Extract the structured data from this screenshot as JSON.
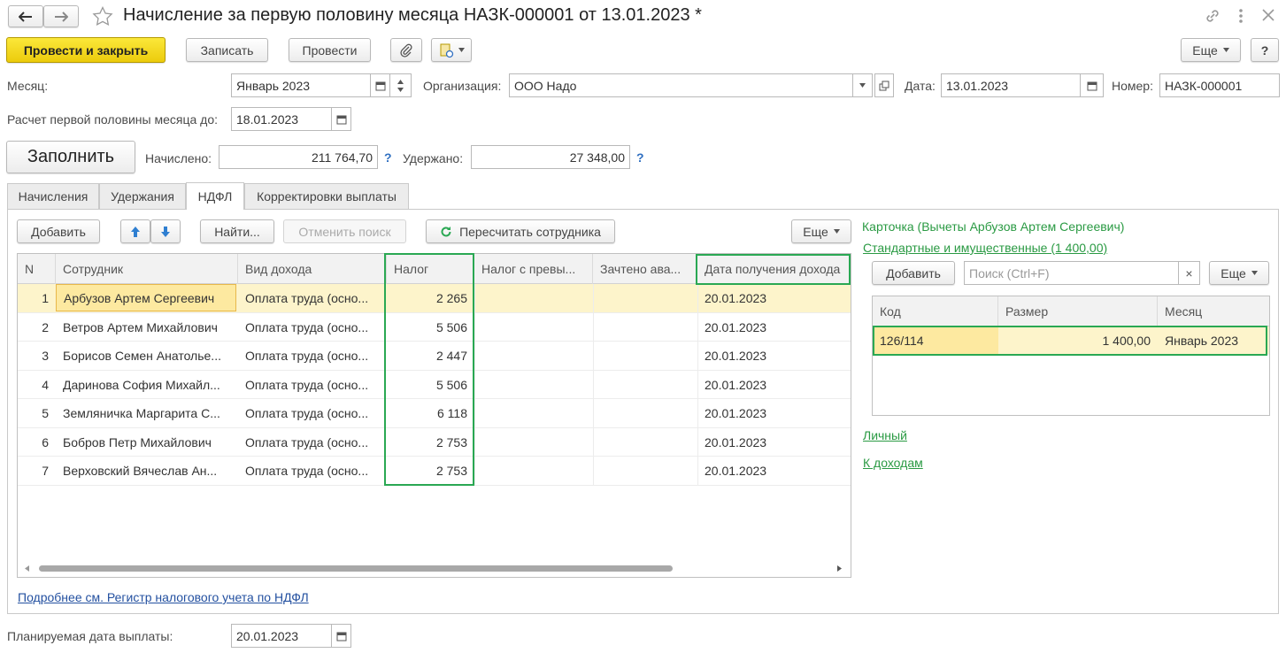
{
  "window": {
    "title": "Начисление за первую половину месяца НАЗК-000001 от 13.01.2023 *"
  },
  "toolbar": {
    "post_close": "Провести и закрыть",
    "save": "Записать",
    "post": "Провести",
    "more": "Еще",
    "help": "?"
  },
  "fields": {
    "month_label": "Месяц:",
    "month_value": "Январь 2023",
    "org_label": "Организация:",
    "org_value": "ООО Надо",
    "date_label": "Дата:",
    "date_value": "13.01.2023",
    "number_label": "Номер:",
    "number_value": "НАЗК-000001",
    "calc_until_label": "Расчет первой половины месяца до:",
    "calc_until_value": "18.01.2023"
  },
  "summary": {
    "fill_button": "Заполнить",
    "accrued_label": "Начислено:",
    "accrued_value": "211 764,70",
    "withheld_label": "Удержано:",
    "withheld_value": "27 348,00",
    "q": "?"
  },
  "tabs": [
    {
      "label": "Начисления"
    },
    {
      "label": "Удержания"
    },
    {
      "label": "НДФЛ"
    },
    {
      "label": "Корректировки выплаты"
    }
  ],
  "ndfl_toolbar": {
    "add": "Добавить",
    "find": "Найти...",
    "cancel_search": "Отменить поиск",
    "recalc": "Пересчитать сотрудника",
    "more": "Еще"
  },
  "table": {
    "headers": [
      "N",
      "Сотрудник",
      "Вид дохода",
      "Налог",
      "Налог с превы...",
      "Зачтено ава...",
      "Дата получения дохода"
    ],
    "rows": [
      {
        "n": "1",
        "employee": "Арбузов Артем Сергеевич",
        "income": "Оплата труда (осно...",
        "tax": "2 265",
        "date": "20.01.2023"
      },
      {
        "n": "2",
        "employee": "Ветров Артем Михайлович",
        "income": "Оплата труда (осно...",
        "tax": "5 506",
        "date": "20.01.2023"
      },
      {
        "n": "3",
        "employee": "Борисов Семен Анатолье...",
        "income": "Оплата труда (осно...",
        "tax": "2 447",
        "date": "20.01.2023"
      },
      {
        "n": "4",
        "employee": "Даринова София Михайл...",
        "income": "Оплата труда (осно...",
        "tax": "5 506",
        "date": "20.01.2023"
      },
      {
        "n": "5",
        "employee": "Земляничка Маргарита С...",
        "income": "Оплата труда (осно...",
        "tax": "6 118",
        "date": "20.01.2023"
      },
      {
        "n": "6",
        "employee": "Бобров Петр Михайлович",
        "income": "Оплата труда (осно...",
        "tax": "2 753",
        "date": "20.01.2023"
      },
      {
        "n": "7",
        "employee": "Верховский Вячеслав Ан...",
        "income": "Оплата труда (осно...",
        "tax": "2 753",
        "date": "20.01.2023"
      }
    ]
  },
  "links": {
    "register": "Подробнее см. Регистр налогового учета по НДФЛ"
  },
  "card": {
    "title": "Карточка (Вычеты Арбузов Артем Сергеевич)",
    "standard_link": "Стандартные и имущественные (1 400,00)",
    "add": "Добавить",
    "search_placeholder": "Поиск (Ctrl+F)",
    "clear": "×",
    "more": "Еще",
    "headers": [
      "Код",
      "Размер",
      "Месяц"
    ],
    "row": {
      "code": "126/114",
      "amount": "1 400,00",
      "month": "Январь 2023"
    },
    "personal_link": "Личный",
    "income_link": "К доходам"
  },
  "footer": {
    "planned_label": "Планируемая дата выплаты:",
    "planned_value": "20.01.2023"
  },
  "colors": {
    "highlight_green": "#2aa853",
    "selection": "#fdf4cb",
    "primary_yellow": "#f4d91f"
  }
}
